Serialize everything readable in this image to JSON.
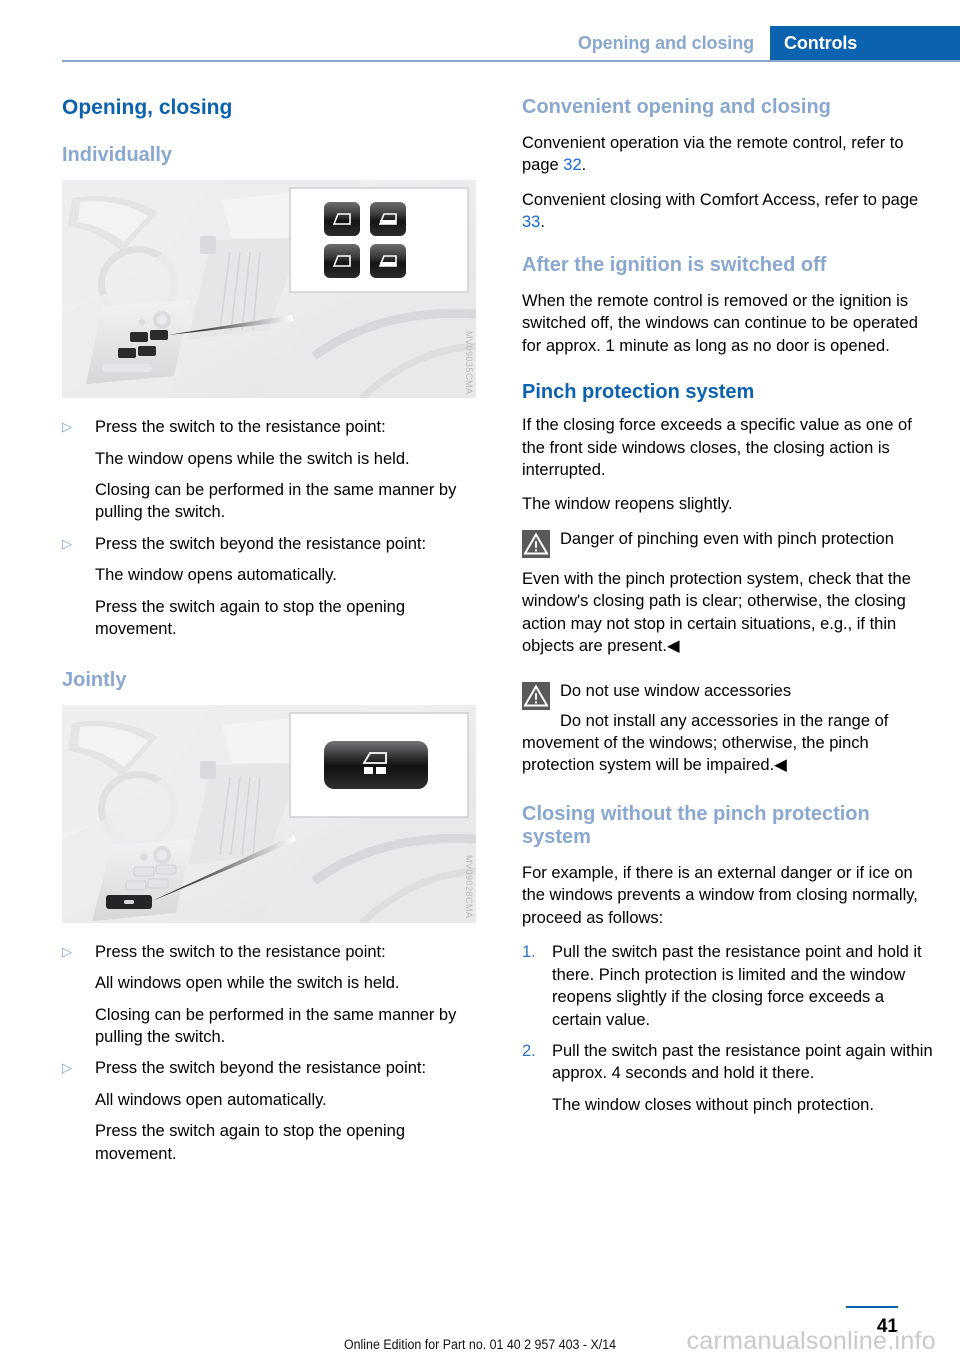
{
  "header": {
    "chapter": "Opening and closing",
    "section": "Controls"
  },
  "left_column": {
    "title": "Opening, closing",
    "subsection_1": {
      "heading": "Individually",
      "figure_code": "MV09035CMA",
      "items": [
        {
          "marker": "▷",
          "text": "Press the switch to the resistance point:",
          "continuations": [
            "The window opens while the switch is held.",
            "Closing can be performed in the same manner by pulling the switch."
          ]
        },
        {
          "marker": "▷",
          "text": "Press the switch beyond the resistance point:",
          "continuations": [
            "The window opens automatically.",
            "Press the switch again to stop the opening movement."
          ]
        }
      ]
    },
    "subsection_2": {
      "heading": "Jointly",
      "figure_code": "MV09028CMA",
      "items": [
        {
          "marker": "▷",
          "text": "Press the switch to the resistance point:",
          "continuations": [
            "All windows open while the switch is held.",
            "Closing can be performed in the same manner by pulling the switch."
          ]
        },
        {
          "marker": "▷",
          "text": "Press the switch beyond the resistance point:",
          "continuations": [
            "All windows open automatically.",
            "Press the switch again to stop the opening movement."
          ]
        }
      ]
    }
  },
  "right_column": {
    "section_1": {
      "heading": "Convenient opening and closing",
      "para_1_before": "Convenient operation via the remote control, refer to page ",
      "para_1_ref": "32",
      "para_1_after": ".",
      "para_2_before": "Convenient closing with Comfort Access, refer to page ",
      "para_2_ref": "33",
      "para_2_after": "."
    },
    "section_2": {
      "heading": "After the ignition is switched off",
      "para": "When the remote control is removed or the ignition is switched off, the windows can continue to be operated for approx. 1 minute as long as no door is opened."
    },
    "section_3": {
      "heading": "Pinch protection system",
      "para_1": "If the closing force exceeds a specific value as one of the front side windows closes, the closing action is interrupted.",
      "para_2": "The window reopens slightly.",
      "warning_1": {
        "icon": "warning-triangle-icon",
        "title": "Danger of pinching even with pinch protection",
        "body": "Even with the pinch protection system, check that the window's closing path is clear; otherwise, the closing action may not stop in certain situations, e.g., if thin objects are present.◀"
      },
      "warning_2": {
        "icon": "warning-triangle-icon",
        "title": "Do not use window accessories",
        "body": "Do not install any accessories in the range of movement of the windows; otherwise, the pinch protection system will be impaired.◀"
      }
    },
    "section_4": {
      "heading": "Closing without the pinch protection system",
      "intro": "For example, if there is an external danger or if ice on the windows prevents a window from closing normally, proceed as follows:",
      "steps": [
        {
          "marker": "1.",
          "text": "Pull the switch past the resistance point and hold it there. Pinch protection is limited and the window reopens slightly if the closing force exceeds a certain value.",
          "continuations": []
        },
        {
          "marker": "2.",
          "text": "Pull the switch past the resistance point again within approx. 4 seconds and hold it there.",
          "continuations": [
            "The window closes without pinch protection."
          ]
        }
      ]
    }
  },
  "footer": {
    "note": "Online Edition for Part no. 01 40 2 957 403 - X/14",
    "page_number": "41",
    "watermark": "carmanualsonline.info"
  },
  "colors": {
    "accent_blue": "#0b62ae",
    "light_blue": "#8aa7d0",
    "link_blue": "#1268dd",
    "warn_gray": "#5a5a5a"
  }
}
